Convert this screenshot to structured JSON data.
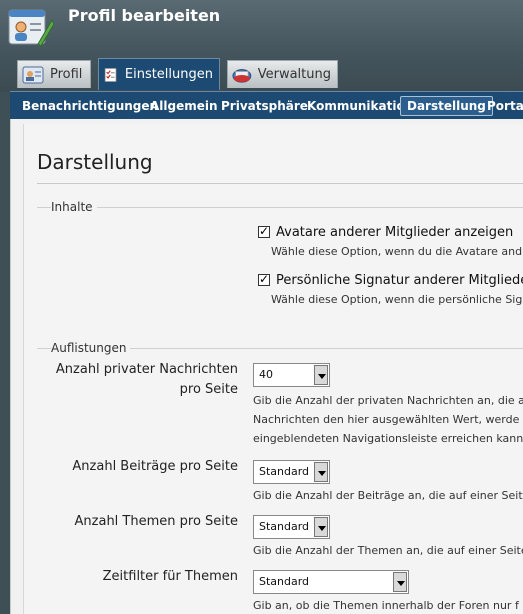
{
  "header": {
    "title": "Profil bearbeiten"
  },
  "tabs": [
    {
      "label": "Profil",
      "icon": "profile-card-icon"
    },
    {
      "label": "Einstellungen",
      "icon": "checklist-icon",
      "active": true
    },
    {
      "label": "Verwaltung",
      "icon": "folder-icon"
    }
  ],
  "subnav": [
    {
      "label": "Benachrichtigungen"
    },
    {
      "label": "Allgemein"
    },
    {
      "label": "Privatsphäre"
    },
    {
      "label": "Kommunikation"
    },
    {
      "label": "Darstellung",
      "active": true
    },
    {
      "label": "Portal"
    }
  ],
  "page": {
    "title": "Darstellung",
    "inhalte": {
      "legend": "Inhalte",
      "options": [
        {
          "label": "Avatare anderer Mitglieder anzeigen",
          "hint": "Wähle diese Option, wenn du die Avatare and",
          "checked": true
        },
        {
          "label": "Persönliche Signatur anderer Mitglieder",
          "hint": "Wähle diese Option, wenn die persönliche Sig",
          "checked": true
        }
      ]
    },
    "auflistungen": {
      "legend": "Auflistungen",
      "fields": [
        {
          "label_line1": "Anzahl privater Nachrichten",
          "label_line2": "pro Seite",
          "value": "40",
          "hint_lines": [
            "Gib die Anzahl der privaten Nachrichten an, die a",
            "Nachrichten den hier ausgewählten Wert, werde",
            "eingeblendeten Navigationsleiste erreichen kann"
          ]
        },
        {
          "label": "Anzahl Beiträge pro Seite",
          "value": "Standard",
          "hint": "Gib die Anzahl der Beiträge an, die auf einer Seit"
        },
        {
          "label": "Anzahl Themen pro Seite",
          "value": "Standard",
          "hint": "Gib die Anzahl der Themen an, die auf einer Seite"
        },
        {
          "label": "Zeitfilter für Themen",
          "value": "Standard",
          "hint": "Gib an, ob die Themen innerhalb der Foren nur f"
        }
      ]
    }
  },
  "colors": {
    "nav_blue": "#1d4a72",
    "header_bg": "#44545c",
    "panel_bg": "#f4f4f4"
  }
}
